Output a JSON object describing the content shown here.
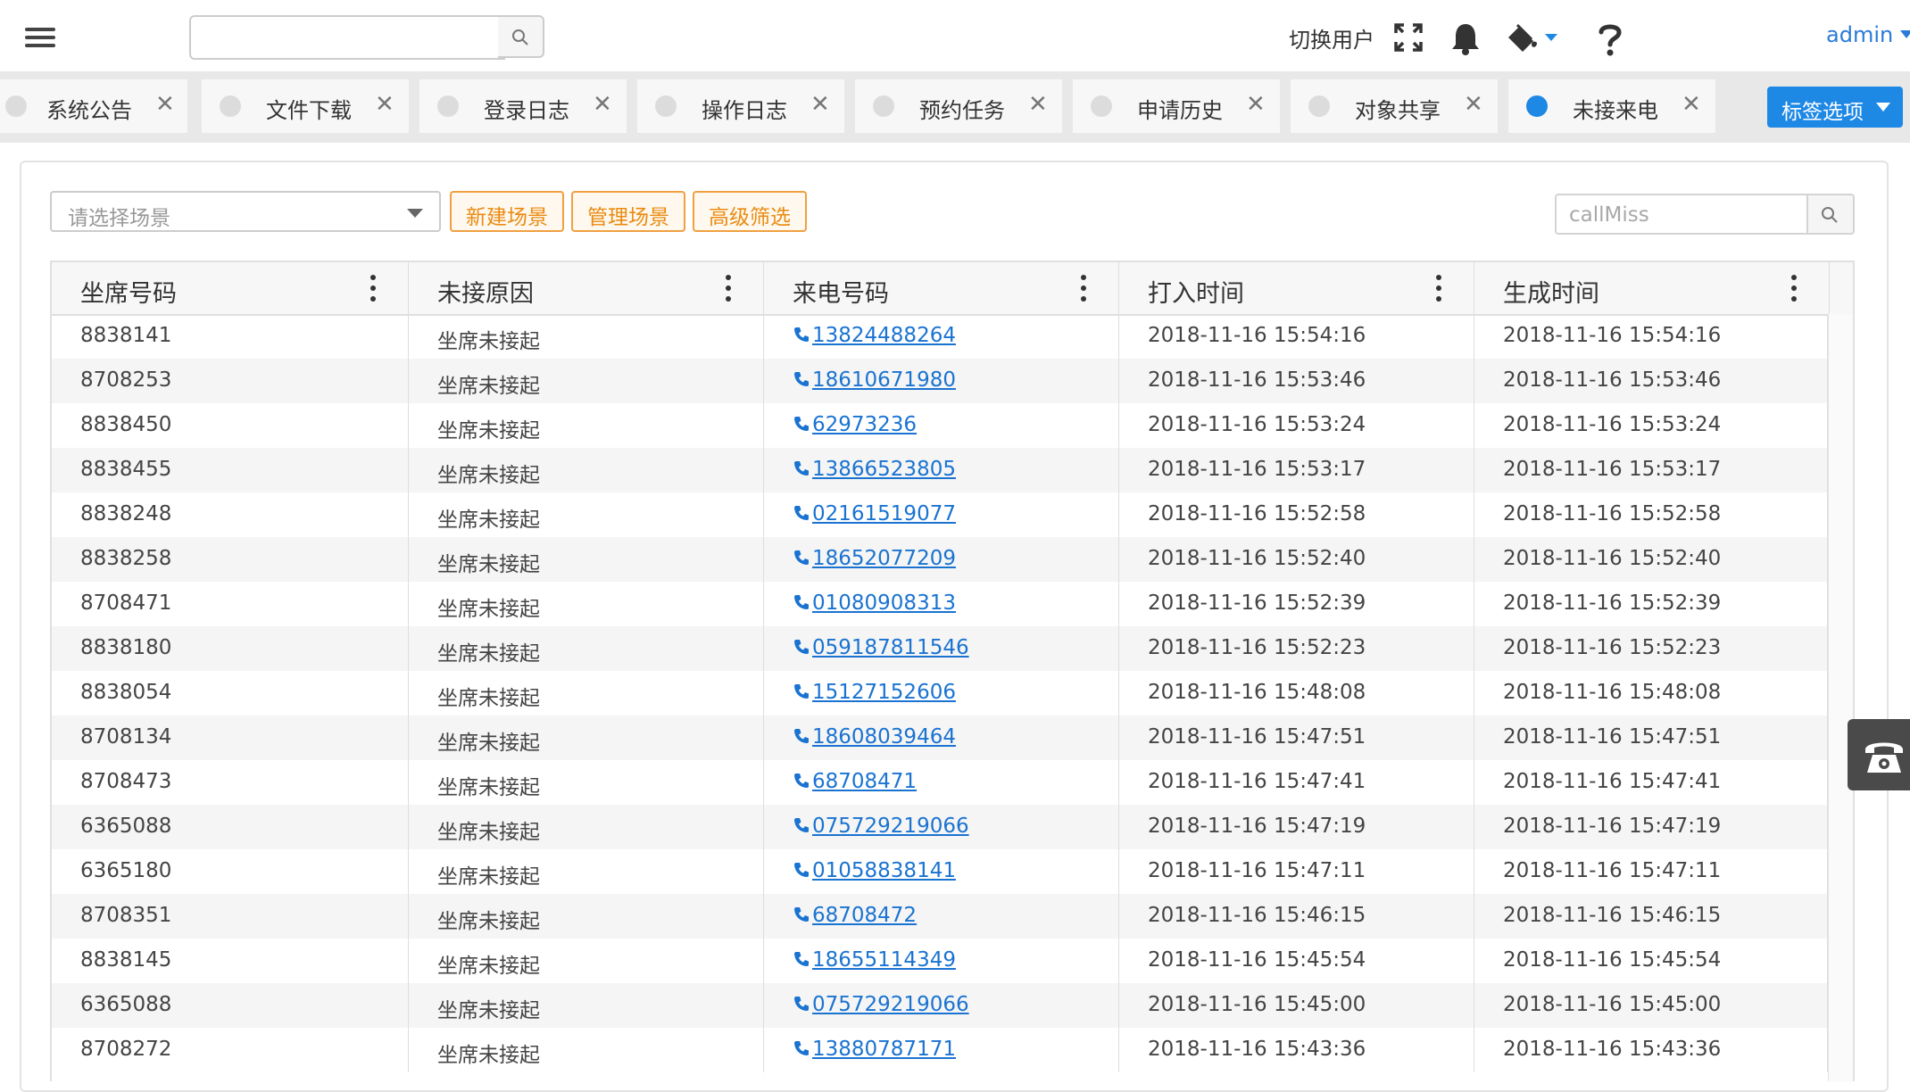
{
  "header": {
    "search_value": "",
    "switch_user": "切换用户",
    "user": "admin",
    "icons": [
      "menu-icon",
      "search-icon",
      "fullscreen-icon",
      "bell-icon",
      "paint-bucket-icon",
      "help-icon"
    ]
  },
  "tabs": [
    {
      "label": "系统公告",
      "active": false
    },
    {
      "label": "文件下载",
      "active": false
    },
    {
      "label": "登录日志",
      "active": false
    },
    {
      "label": "操作日志",
      "active": false
    },
    {
      "label": "预约任务",
      "active": false
    },
    {
      "label": "申请历史",
      "active": false
    },
    {
      "label": "对象共享",
      "active": false
    },
    {
      "label": "未接来电",
      "active": true
    }
  ],
  "tab_options_label": "标签选项",
  "toolbar": {
    "scene_placeholder": "请选择场景",
    "new_scene": "新建场景",
    "manage_scene": "管理场景",
    "advanced_filter": "高级筛选",
    "search_placeholder": "callMiss"
  },
  "table": {
    "columns": [
      "坐席号码",
      "未接原因",
      "来电号码",
      "打入时间",
      "生成时间"
    ],
    "rows": [
      [
        "8838141",
        "坐席未接起",
        "13824488264",
        "2018-11-16 15:54:16",
        "2018-11-16 15:54:16"
      ],
      [
        "8708253",
        "坐席未接起",
        "18610671980",
        "2018-11-16 15:53:46",
        "2018-11-16 15:53:46"
      ],
      [
        "8838450",
        "坐席未接起",
        "62973236",
        "2018-11-16 15:53:24",
        "2018-11-16 15:53:24"
      ],
      [
        "8838455",
        "坐席未接起",
        "13866523805",
        "2018-11-16 15:53:17",
        "2018-11-16 15:53:17"
      ],
      [
        "8838248",
        "坐席未接起",
        "02161519077",
        "2018-11-16 15:52:58",
        "2018-11-16 15:52:58"
      ],
      [
        "8838258",
        "坐席未接起",
        "18652077209",
        "2018-11-16 15:52:40",
        "2018-11-16 15:52:40"
      ],
      [
        "8708471",
        "坐席未接起",
        "01080908313",
        "2018-11-16 15:52:39",
        "2018-11-16 15:52:39"
      ],
      [
        "8838180",
        "坐席未接起",
        "059187811546",
        "2018-11-16 15:52:23",
        "2018-11-16 15:52:23"
      ],
      [
        "8838054",
        "坐席未接起",
        "15127152606",
        "2018-11-16 15:48:08",
        "2018-11-16 15:48:08"
      ],
      [
        "8708134",
        "坐席未接起",
        "18608039464",
        "2018-11-16 15:47:51",
        "2018-11-16 15:47:51"
      ],
      [
        "8708473",
        "坐席未接起",
        "68708471",
        "2018-11-16 15:47:41",
        "2018-11-16 15:47:41"
      ],
      [
        "6365088",
        "坐席未接起",
        "075729219066",
        "2018-11-16 15:47:19",
        "2018-11-16 15:47:19"
      ],
      [
        "6365180",
        "坐席未接起",
        "01058838141",
        "2018-11-16 15:47:11",
        "2018-11-16 15:47:11"
      ],
      [
        "8708351",
        "坐席未接起",
        "68708472",
        "2018-11-16 15:46:15",
        "2018-11-16 15:46:15"
      ],
      [
        "8838145",
        "坐席未接起",
        "18655114349",
        "2018-11-16 15:45:54",
        "2018-11-16 15:45:54"
      ],
      [
        "6365088",
        "坐席未接起",
        "075729219066",
        "2018-11-16 15:45:00",
        "2018-11-16 15:45:00"
      ],
      [
        "8708272",
        "坐席未接起",
        "13880787171",
        "2018-11-16 15:43:36",
        "2018-11-16 15:43:36"
      ]
    ]
  },
  "colors": {
    "accent": "#1e88e5",
    "link": "#1a73d1",
    "orange_button": "#e98b12"
  }
}
